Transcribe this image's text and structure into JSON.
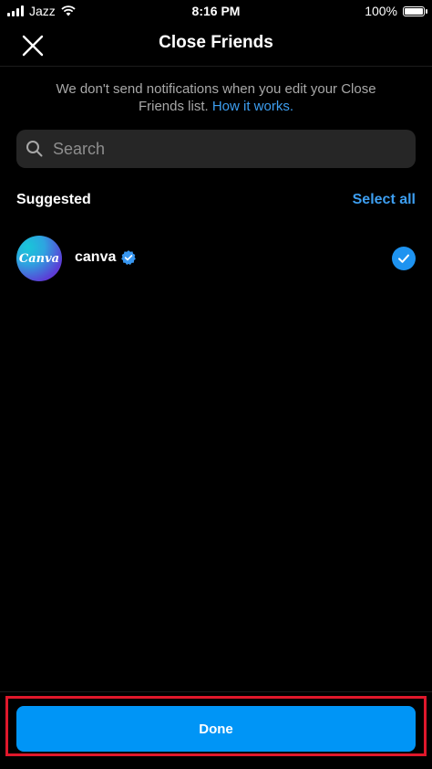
{
  "status_bar": {
    "carrier": "Jazz",
    "time": "8:16 PM",
    "battery": "100%"
  },
  "header": {
    "title": "Close Friends",
    "close_icon": "close-icon"
  },
  "notice": {
    "text": "We don't send notifications when you edit your Close Friends list.",
    "link": "How it works."
  },
  "search": {
    "placeholder": "Search",
    "value": ""
  },
  "suggested": {
    "title": "Suggested",
    "select_all": "Select all",
    "items": [
      {
        "username": "canva",
        "avatar_text": "Canva",
        "verified": true,
        "selected": true
      }
    ]
  },
  "footer": {
    "done_label": "Done"
  },
  "colors": {
    "background": "#000000",
    "accent": "#0095f6",
    "link": "#3d9ef0",
    "highlight_border": "#e0182b"
  }
}
